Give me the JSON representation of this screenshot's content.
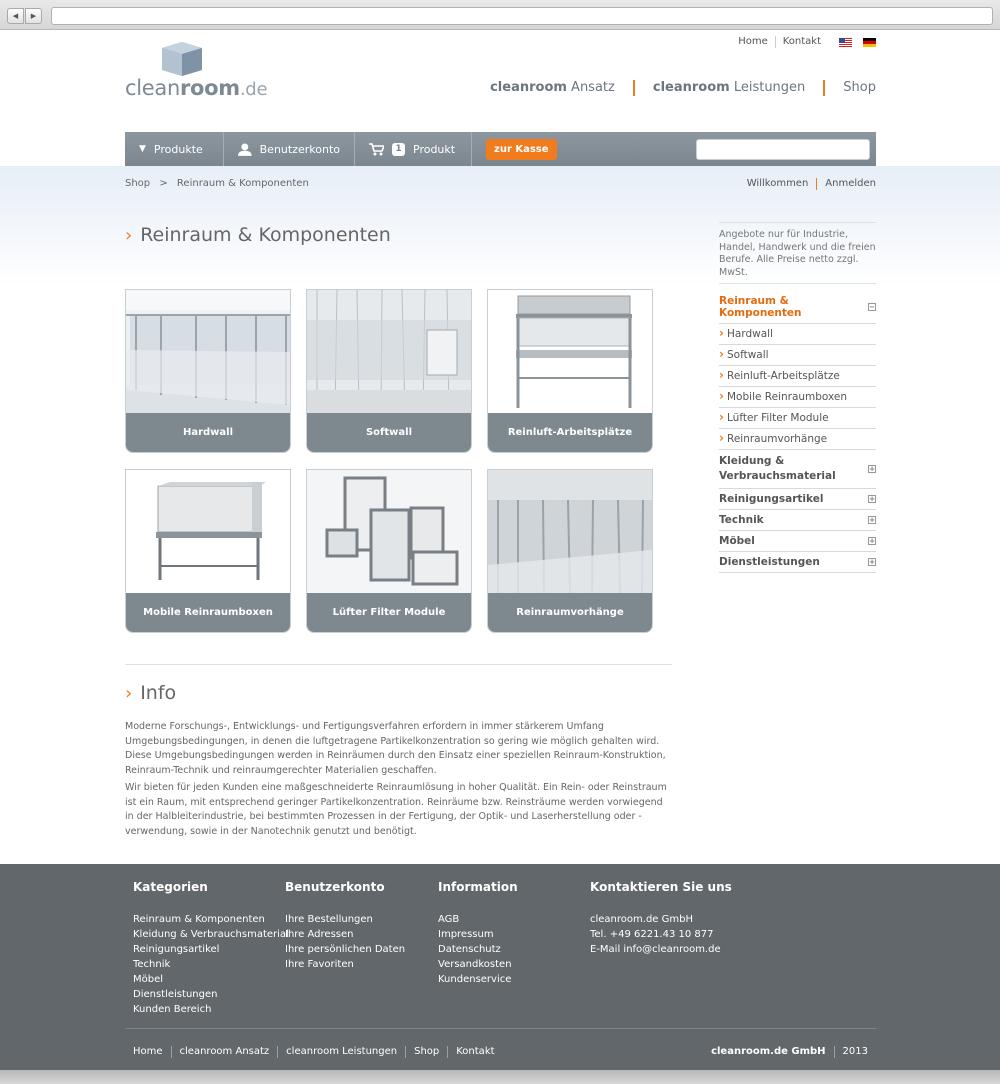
{
  "toplinks": {
    "home": "Home",
    "contact": "Kontakt"
  },
  "logo": {
    "part1": "clean",
    "part2": "room",
    "part3": ".de"
  },
  "mainnav": [
    {
      "bold": "cleanroom",
      "rest": " Ansatz"
    },
    {
      "bold": "cleanroom",
      "rest": " Leistungen"
    },
    {
      "bold": "",
      "rest": "Shop"
    }
  ],
  "toolbar": {
    "products": "Produkte",
    "account": "Benutzerkonto",
    "cart_count": "1",
    "cart_label": "Produkt",
    "checkout": "zur Kasse",
    "search_placeholder": ""
  },
  "breadcrumb": {
    "root": "Shop",
    "sep": ">",
    "current": "Reinraum & Komponenten"
  },
  "userlinks": {
    "welcome": "Willkommen",
    "login": "Anmelden"
  },
  "page_title": "Reinraum & Komponenten",
  "tiles": [
    {
      "label": "Hardwall"
    },
    {
      "label": "Softwall"
    },
    {
      "label": "Reinluft-Arbeitsplätze"
    },
    {
      "label": "Mobile Reinraumboxen"
    },
    {
      "label": "Lüfter Filter Module"
    },
    {
      "label": "Reinraumvorhänge"
    }
  ],
  "aside_note": "Angebote nur für Industrie, Handel, Handwerk und die freien Berufe. Alle Preise netto zzgl. MwSt.",
  "categories": {
    "active": "Reinraum & Komponenten",
    "subs": [
      "Hardwall",
      "Softwall",
      "Reinluft-Arbeitsplätze",
      "Mobile Reinraumboxen",
      "Lüfter Filter Module",
      "Reinraumvorhänge"
    ],
    "others": [
      "Kleidung & Verbrauchsmaterial",
      "Reinigungsartikel",
      "Technik",
      "Möbel",
      "Dienstleistungen"
    ]
  },
  "info": {
    "title": "Info",
    "p1": "Moderne Forschungs-, Entwicklungs- und Fertigungsverfahren erfordern in immer stärkerem Umfang Umgebungsbedingungen, in denen die luftgetragene Partikelkonzentration so gering wie möglich gehalten wird. Diese Umgebungsbedingungen werden in Reinräumen durch den Einsatz einer speziellen Reinraum-Konstruktion, Reinraum-Technik und reinraumgerechter Materialien geschaffen.",
    "p2": "Wir bieten für jeden Kunden eine maßgeschneiderte Reinraumlösung in hoher Qualität. Ein Rein- oder Reinstraum ist ein Raum, mit entsprechend geringer Partikelkonzentration. Reinräume bzw. Reinsträume werden vorwiegend in der Halbleiterindustrie, bei bestimmten Prozessen in der Fertigung, der Optik- und Laserherstellung oder -verwendung, sowie in der Nanotechnik genutzt und benötigt."
  },
  "footer": {
    "col1": {
      "title": "Kategorien",
      "links": [
        "Reinraum & Komponenten",
        "Kleidung & Verbrauchsmaterial",
        "Reinigungsartikel",
        "Technik",
        "Möbel",
        "Dienstleistungen",
        "Kunden Bereich"
      ]
    },
    "col2": {
      "title": "Benutzerkonto",
      "links": [
        "Ihre Bestellungen",
        "Ihre Adressen",
        "Ihre persönlichen Daten",
        "Ihre Favoriten"
      ]
    },
    "col3": {
      "title": "Information",
      "links": [
        "AGB",
        "Impressum",
        "Datenschutz",
        "Versandkosten",
        "Kundenservice"
      ]
    },
    "col4": {
      "title": "Kontaktieren Sie uns",
      "lines": [
        "cleanroom.de GmbH",
        "Tel. +49 6221.43 10 877",
        "E-Mail info@cleanroom.de"
      ]
    },
    "bottom": [
      "Home",
      "cleanroom Ansatz",
      "cleanroom Leistungen",
      "Shop",
      "Kontakt"
    ],
    "company": "cleanroom.de GmbH",
    "year": "2013"
  },
  "colors": {
    "accent": "#f07c1e",
    "toolbar": "#7e888f",
    "footer": "#62676b"
  }
}
